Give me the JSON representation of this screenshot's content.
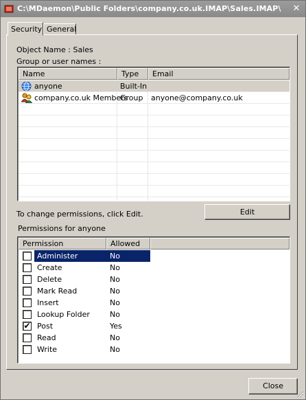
{
  "window": {
    "title": "C:\\MDaemon\\Public Folders\\company.co.uk.IMAP\\Sales.IMAP\\",
    "close_glyph": "✕"
  },
  "tabs": [
    {
      "label": "Security",
      "active": true
    },
    {
      "label": "General",
      "active": false
    }
  ],
  "security": {
    "object_name": "Object Name : Sales",
    "group_label": "Group or user names :",
    "users_columns": [
      "Name",
      "Type",
      "Email"
    ],
    "users": [
      {
        "name": "anyone",
        "type": "Built-In",
        "email": "",
        "icon": "globe-icon",
        "selected": true
      },
      {
        "name": "company.co.uk Members",
        "type": "Group",
        "email": "anyone@company.co.uk",
        "icon": "group-icon",
        "selected": false
      }
    ],
    "edit_hint": "To change permissions, click Edit.",
    "edit_label": "Edit",
    "permissions_label": "Permissions for  anyone",
    "perm_columns": [
      "Permission",
      "Allowed"
    ],
    "permissions": [
      {
        "name": "Administer",
        "allowed": "No",
        "checked": false,
        "selected": true
      },
      {
        "name": "Create",
        "allowed": "No",
        "checked": false,
        "selected": false
      },
      {
        "name": "Delete",
        "allowed": "No",
        "checked": false,
        "selected": false
      },
      {
        "name": "Mark Read",
        "allowed": "No",
        "checked": false,
        "selected": false
      },
      {
        "name": "Insert",
        "allowed": "No",
        "checked": false,
        "selected": false
      },
      {
        "name": "Lookup Folder",
        "allowed": "No",
        "checked": false,
        "selected": false
      },
      {
        "name": "Post",
        "allowed": "Yes",
        "checked": true,
        "selected": false
      },
      {
        "name": "Read",
        "allowed": "No",
        "checked": false,
        "selected": false
      },
      {
        "name": "Write",
        "allowed": "No",
        "checked": false,
        "selected": false
      }
    ],
    "checkmark_glyph": "✔"
  },
  "footer": {
    "close_label": "Close"
  },
  "colors": {
    "selection": "#0a246a",
    "user_selection": "#d4d0c8",
    "face": "#d4d0c8"
  }
}
